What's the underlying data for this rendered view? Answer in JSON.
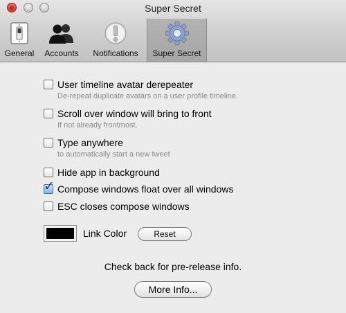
{
  "window": {
    "title": "Super Secret"
  },
  "tabs": [
    {
      "label": "General",
      "icon": "light-switch-icon",
      "active": false
    },
    {
      "label": "Accounts",
      "icon": "people-icon",
      "active": false
    },
    {
      "label": "Notifications",
      "icon": "exclamation-icon",
      "active": false
    },
    {
      "label": "Super Secret",
      "icon": "gear-icon",
      "active": true
    }
  ],
  "options": [
    {
      "label": "User timeline avatar derepeater",
      "description": "De-repeat duplicate avatars on a user profile timeline.",
      "checked": false
    },
    {
      "label": "Scroll over window will bring to front",
      "description": "If not already frontmost.",
      "checked": false
    },
    {
      "label": "Type anywhere",
      "description": "to automatically start a new tweet",
      "checked": false
    },
    {
      "label": "Hide app in background",
      "checked": false
    },
    {
      "label": "Compose windows float over all windows",
      "checked": true
    },
    {
      "label": "ESC closes compose windows",
      "checked": false
    }
  ],
  "link_color": {
    "label": "Link Color",
    "color": "#000000",
    "reset_label": "Reset"
  },
  "footer": {
    "message": "Check back for pre-release info.",
    "more_info_label": "More Info..."
  },
  "colors": {
    "close_button": "#e0443a",
    "check_accent": "#8ab6ec"
  }
}
